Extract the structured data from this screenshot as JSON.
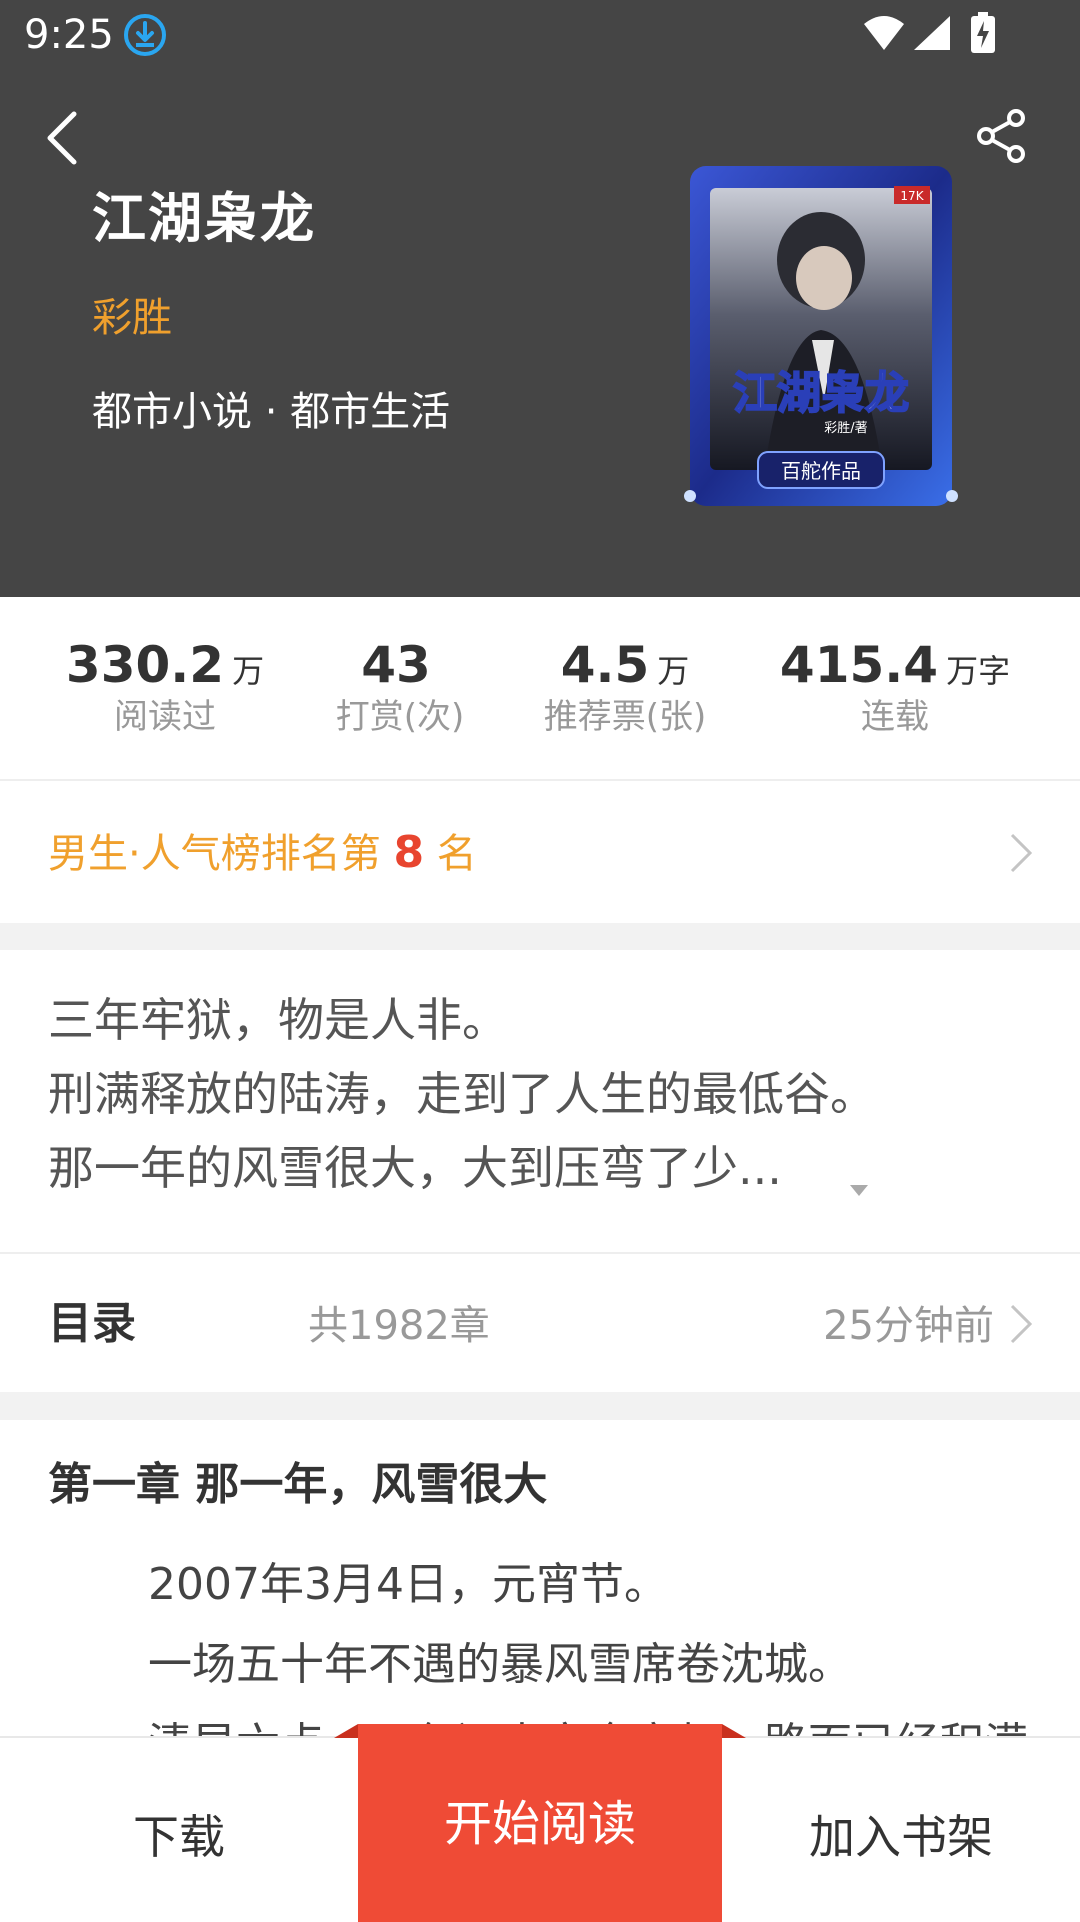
{
  "status_bar": {
    "time": "9:25"
  },
  "book": {
    "title": "江湖枭龙",
    "author": "彩胜",
    "genre": "都市小说 · 都市生活",
    "cover": {
      "title_text": "江湖枭龙",
      "sub_text": "彩胜/著",
      "badge_text": "百舵作品",
      "corner_text": "17K"
    }
  },
  "stats": [
    {
      "value": "330.2",
      "unit": "万",
      "label": "阅读过"
    },
    {
      "value": "43",
      "unit": "",
      "label": "打赏(次)"
    },
    {
      "value": "4.5",
      "unit": "万",
      "label": "推荐票(张)"
    },
    {
      "value": "415.4",
      "unit": "万字",
      "label": "连载"
    }
  ],
  "rank": {
    "prefix": "男生·人气榜排名第 ",
    "number": "8",
    "suffix": " 名"
  },
  "synopsis": {
    "lines": [
      "三年牢狱，物是人非。",
      "刑满释放的陆涛，走到了人生的最低谷。",
      "那一年的风雪很大，大到压弯了少..."
    ]
  },
  "toc": {
    "title": "目录",
    "count": "共1982章",
    "updated": "25分钟前"
  },
  "chapter": {
    "title": "第一章 那一年，风雪很大",
    "lines": [
      "2007年3月4日，元宵节。",
      "一场五十年不遇的暴风雪席卷沈城。",
      "清早六点，天色还未完全亮起，路面已经积满"
    ]
  },
  "bottom_bar": {
    "download": "下载",
    "read": "开始阅读",
    "add_shelf": "加入书架"
  },
  "colors": {
    "header_bg": "#454545",
    "accent_orange": "#f0a02d",
    "accent_red": "#ef4b36"
  }
}
